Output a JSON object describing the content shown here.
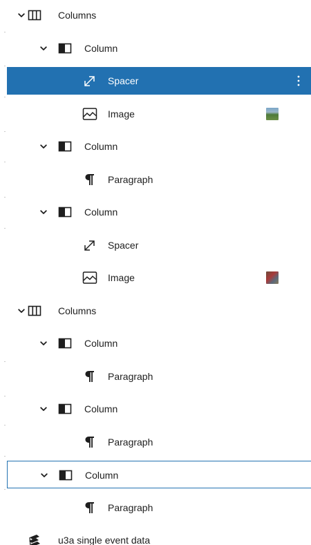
{
  "list_view": {
    "items": [
      {
        "label": "Columns",
        "icon": "columns-icon",
        "depth": 0,
        "expanded": true
      },
      {
        "label": "Column",
        "icon": "column-icon",
        "depth": 1,
        "expanded": true
      },
      {
        "label": "Spacer",
        "icon": "spacer-icon",
        "depth": 2,
        "selected": true
      },
      {
        "label": "Image",
        "icon": "image-icon",
        "depth": 2,
        "thumbnail": "landscape"
      },
      {
        "label": "Column",
        "icon": "column-icon",
        "depth": 1,
        "expanded": true
      },
      {
        "label": "Paragraph",
        "icon": "paragraph-icon",
        "depth": 2
      },
      {
        "label": "Column",
        "icon": "column-icon",
        "depth": 1,
        "expanded": true
      },
      {
        "label": "Spacer",
        "icon": "spacer-icon",
        "depth": 2
      },
      {
        "label": "Image",
        "icon": "image-icon",
        "depth": 2,
        "thumbnail": "people"
      },
      {
        "label": "Columns",
        "icon": "columns-icon",
        "depth": 0,
        "expanded": true
      },
      {
        "label": "Column",
        "icon": "column-icon",
        "depth": 1,
        "expanded": true
      },
      {
        "label": "Paragraph",
        "icon": "paragraph-icon",
        "depth": 2
      },
      {
        "label": "Column",
        "icon": "column-icon",
        "depth": 1,
        "expanded": true
      },
      {
        "label": "Paragraph",
        "icon": "paragraph-icon",
        "depth": 2
      },
      {
        "label": "Column",
        "icon": "column-icon",
        "depth": 1,
        "expanded": true,
        "focused": true
      },
      {
        "label": "Paragraph",
        "icon": "paragraph-icon",
        "depth": 2
      },
      {
        "label": "u3a single event data",
        "icon": "event-data-icon",
        "depth": 0
      }
    ]
  },
  "colors": {
    "selected_background": "#2271b1",
    "selected_text": "#ffffff",
    "text": "#1e1e1e",
    "focus_border": "#2271b1"
  }
}
